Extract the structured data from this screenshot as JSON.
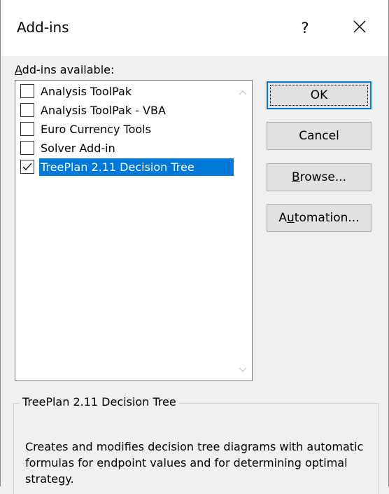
{
  "window": {
    "title": "Add-ins",
    "help_label": "?",
    "close_icon": "close-icon"
  },
  "addins": {
    "label_prefix": "A",
    "label_rest": "dd-ins available:",
    "items": [
      {
        "label": "Analysis ToolPak",
        "checked": false
      },
      {
        "label": "Analysis ToolPak - VBA",
        "checked": false
      },
      {
        "label": "Euro Currency Tools",
        "checked": false
      },
      {
        "label": "Solver Add-in",
        "checked": false
      },
      {
        "label": "TreePlan 2.11 Decision Tree",
        "checked": true,
        "selected": true
      }
    ],
    "scroll_up_icon": "chevron-up-icon",
    "scroll_down_icon": "chevron-down-icon"
  },
  "buttons": {
    "ok": "OK",
    "cancel": "Cancel",
    "browse_ul": "B",
    "browse_rest": "rowse...",
    "automation_pre": "A",
    "automation_ul": "u",
    "automation_rest": "tomation..."
  },
  "description": {
    "title": "TreePlan 2.11 Decision Tree",
    "text": "Creates and modifies decision tree diagrams with automatic formulas for endpoint values and for determining optimal strategy."
  },
  "colors": {
    "selection": "#0078d7",
    "background": "#f0f0f0",
    "button_face": "#e1e1e1"
  }
}
